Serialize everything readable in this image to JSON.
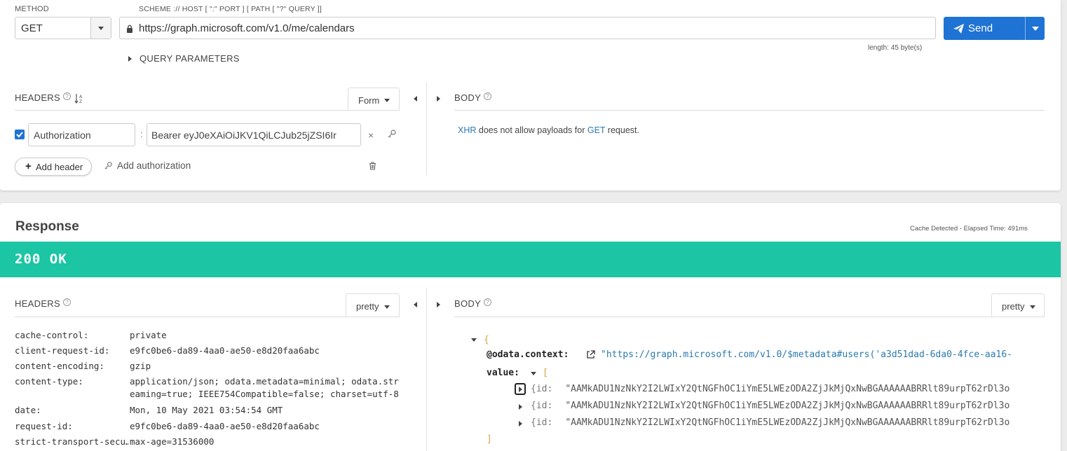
{
  "request": {
    "method_label": "METHOD",
    "method_value": "GET",
    "url_label": "SCHEME :// HOST [ \":\" PORT ] [ PATH [ \"?\" QUERY ]]",
    "url_value": "https://graph.microsoft.com/v1.0/me/calendars",
    "url_length": "length: 45 byte(s)",
    "send_label": "Send",
    "query_params_label": "QUERY PARAMETERS",
    "headers_label": "HEADERS",
    "form_label": "Form",
    "body_label": "BODY",
    "header_name": "Authorization",
    "header_value": "Bearer eyJ0eXAiOiJKV1QiLCJub25jZSI6Ir",
    "add_header_label": "Add header",
    "add_authorization_label": "Add authorization",
    "body_msg_part1": "XHR",
    "body_msg_part2": " does not allow payloads for ",
    "body_msg_part3": "GET",
    "body_msg_part4": " request."
  },
  "response": {
    "title": "Response",
    "cache_info": "Cache Detected - Elapsed Time: 491ms",
    "status_text": "200 OK",
    "status_color": "#1cc5a3",
    "headers_label": "HEADERS",
    "headers_view": "pretty",
    "body_label": "BODY",
    "body_view": "pretty",
    "headers": [
      {
        "key": "cache-control:",
        "value": "private"
      },
      {
        "key": "client-request-id:",
        "value": "e9fc0be6-da89-4aa0-ae50-e8d20faa6abc"
      },
      {
        "key": "content-encoding:",
        "value": "gzip"
      },
      {
        "key": "content-type:",
        "value": "application/json; odata.metadata=minimal; odata.streaming=true; IEEE754Compatible=false; charset=utf-8"
      },
      {
        "key": "date:",
        "value": "Mon, 10 May 2021 03:54:54 GMT"
      },
      {
        "key": "request-id:",
        "value": "e9fc0be6-da89-4aa0-ae50-e8d20faa6abc"
      },
      {
        "key": "strict-transport-secu…",
        "value": "max-age=31536000"
      }
    ],
    "json": {
      "open_brace": "{",
      "context_key": "@odata.context:",
      "context_value": "\"https://graph.microsoft.com/v1.0/$metadata#users('a3d51dad-6da0-4fce-aa16-",
      "value_key": "value:",
      "open_bracket": "[",
      "close_bracket": "]",
      "items": [
        {
          "prefix": "{id:",
          "value": "\"AAMkADU1NzNkY2I2LWIxY2QtNGFhOC1iYmE5LWEzODA2ZjJkMjQxNwBGAAAAAABRRlt89urpT62rDl3o"
        },
        {
          "prefix": "{id:",
          "value": "\"AAMkADU1NzNkY2I2LWIxY2QtNGFhOC1iYmE5LWEzODA2ZjJkMjQxNwBGAAAAAABRRlt89urpT62rDl3o"
        },
        {
          "prefix": "{id:",
          "value": "\"AAMkADU1NzNkY2I2LWIxY2QtNGFhOC1iYmE5LWEzODA2ZjJkMjQxNwBGAAAAAABRRlt89urpT62rDl3o"
        }
      ]
    }
  },
  "colors": {
    "send_button": "#1e73d4",
    "checkbox": "#1e73d4",
    "link": "#2a7ab0"
  },
  "icons": [
    "lock-icon",
    "send-icon",
    "help-icon",
    "sort-icon",
    "close-icon",
    "key-icon",
    "trash-icon",
    "plus-icon",
    "external-link-icon"
  ]
}
